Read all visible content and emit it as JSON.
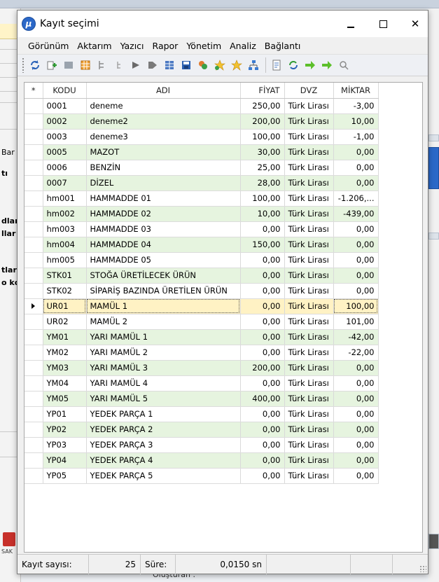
{
  "window": {
    "title": "Kayıt seçimi",
    "icon_letter": "μ"
  },
  "menu": [
    "Görünüm",
    "Aktarım",
    "Yazıcı",
    "Rapor",
    "Yönetim",
    "Analiz",
    "Bağlantı"
  ],
  "toolbar_icons": [
    "refresh-icon",
    "add-icon",
    "list-icon",
    "grid-icon",
    "tree-icon",
    "tree-small-icon",
    "arrow-right-icon",
    "arrow-right-dark-icon",
    "table-icon",
    "save-icon",
    "recycle-icon",
    "star-add-icon",
    "star-icon",
    "network-icon",
    "document-icon",
    "refresh-green-icon",
    "arrow-right-green-icon",
    "arrow-right-green-2-icon",
    "filter-icon"
  ],
  "grid": {
    "columns": [
      "*",
      "KODU",
      "ADI",
      "FİYAT",
      "DVZ",
      "MİKTAR"
    ],
    "selected_index": 13,
    "rows": [
      {
        "kodu": "0001",
        "adi": "deneme",
        "fiyat": "250,00",
        "dvz": "Türk Lirası",
        "miktar": "-3,00"
      },
      {
        "kodu": "0002",
        "adi": "deneme2",
        "fiyat": "200,00",
        "dvz": "Türk Lirası",
        "miktar": "10,00"
      },
      {
        "kodu": "0003",
        "adi": "deneme3",
        "fiyat": "100,00",
        "dvz": "Türk Lirası",
        "miktar": "-1,00"
      },
      {
        "kodu": "0005",
        "adi": "MAZOT",
        "fiyat": "30,00",
        "dvz": "Türk Lirası",
        "miktar": "0,00"
      },
      {
        "kodu": "0006",
        "adi": "BENZİN",
        "fiyat": "25,00",
        "dvz": "Türk Lirası",
        "miktar": "0,00"
      },
      {
        "kodu": "0007",
        "adi": "DİZEL",
        "fiyat": "28,00",
        "dvz": "Türk Lirası",
        "miktar": "0,00"
      },
      {
        "kodu": "hm001",
        "adi": "HAMMADDE 01",
        "fiyat": "100,00",
        "dvz": "Türk Lirası",
        "miktar": "-1.206,..."
      },
      {
        "kodu": "hm002",
        "adi": "HAMMADDE 02",
        "fiyat": "10,00",
        "dvz": "Türk Lirası",
        "miktar": "-439,00"
      },
      {
        "kodu": "hm003",
        "adi": "HAMMADDE 03",
        "fiyat": "0,00",
        "dvz": "Türk Lirası",
        "miktar": "0,00"
      },
      {
        "kodu": "hm004",
        "adi": "HAMMADDE 04",
        "fiyat": "150,00",
        "dvz": "Türk Lirası",
        "miktar": "0,00"
      },
      {
        "kodu": "hm005",
        "adi": "HAMMADDE 05",
        "fiyat": "0,00",
        "dvz": "Türk Lirası",
        "miktar": "0,00"
      },
      {
        "kodu": "STK01",
        "adi": "STOĞA ÜRETİLECEK ÜRÜN",
        "fiyat": "0,00",
        "dvz": "Türk Lirası",
        "miktar": "0,00"
      },
      {
        "kodu": "STK02",
        "adi": "SİPARİŞ BAZINDA ÜRETİLEN ÜRÜN",
        "fiyat": "0,00",
        "dvz": "Türk Lirası",
        "miktar": "0,00"
      },
      {
        "kodu": "UR01",
        "adi": "MAMÜL 1",
        "fiyat": "0,00",
        "dvz": "Türk Lirası",
        "miktar": "100,00"
      },
      {
        "kodu": "UR02",
        "adi": "MAMÜL 2",
        "fiyat": "0,00",
        "dvz": "Türk Lirası",
        "miktar": "101,00"
      },
      {
        "kodu": "YM01",
        "adi": "YARI MAMÜL 1",
        "fiyat": "0,00",
        "dvz": "Türk Lirası",
        "miktar": "-42,00"
      },
      {
        "kodu": "YM02",
        "adi": "YARI MAMÜL 2",
        "fiyat": "0,00",
        "dvz": "Türk Lirası",
        "miktar": "-22,00"
      },
      {
        "kodu": "YM03",
        "adi": "YARI MAMÜL 3",
        "fiyat": "200,00",
        "dvz": "Türk Lirası",
        "miktar": "0,00"
      },
      {
        "kodu": "YM04",
        "adi": "YARI MAMÜL 4",
        "fiyat": "0,00",
        "dvz": "Türk Lirası",
        "miktar": "0,00"
      },
      {
        "kodu": "YM05",
        "adi": "YARI MAMÜL 5",
        "fiyat": "400,00",
        "dvz": "Türk Lirası",
        "miktar": "0,00"
      },
      {
        "kodu": "YP01",
        "adi": "YEDEK PARÇA 1",
        "fiyat": "0,00",
        "dvz": "Türk Lirası",
        "miktar": "0,00"
      },
      {
        "kodu": "YP02",
        "adi": "YEDEK PARÇA 2",
        "fiyat": "0,00",
        "dvz": "Türk Lirası",
        "miktar": "0,00"
      },
      {
        "kodu": "YP03",
        "adi": "YEDEK PARÇA 3",
        "fiyat": "0,00",
        "dvz": "Türk Lirası",
        "miktar": "0,00"
      },
      {
        "kodu": "YP04",
        "adi": "YEDEK PARÇA 4",
        "fiyat": "0,00",
        "dvz": "Türk Lirası",
        "miktar": "0,00"
      },
      {
        "kodu": "YP05",
        "adi": "YEDEK PARÇA 5",
        "fiyat": "0,00",
        "dvz": "Türk Lirası",
        "miktar": "0,00"
      }
    ]
  },
  "status": {
    "record_label": "Kayıt sayısı:",
    "record_count": "25",
    "time_label": "Süre:",
    "time_value": "0,0150 sn"
  },
  "background": {
    "left_fragments": [
      "Bar",
      "tı",
      "dlar",
      "llar",
      "tlar",
      "o kc"
    ],
    "bottom_text": "Oluşturan :",
    "sak_text": "SAK"
  }
}
